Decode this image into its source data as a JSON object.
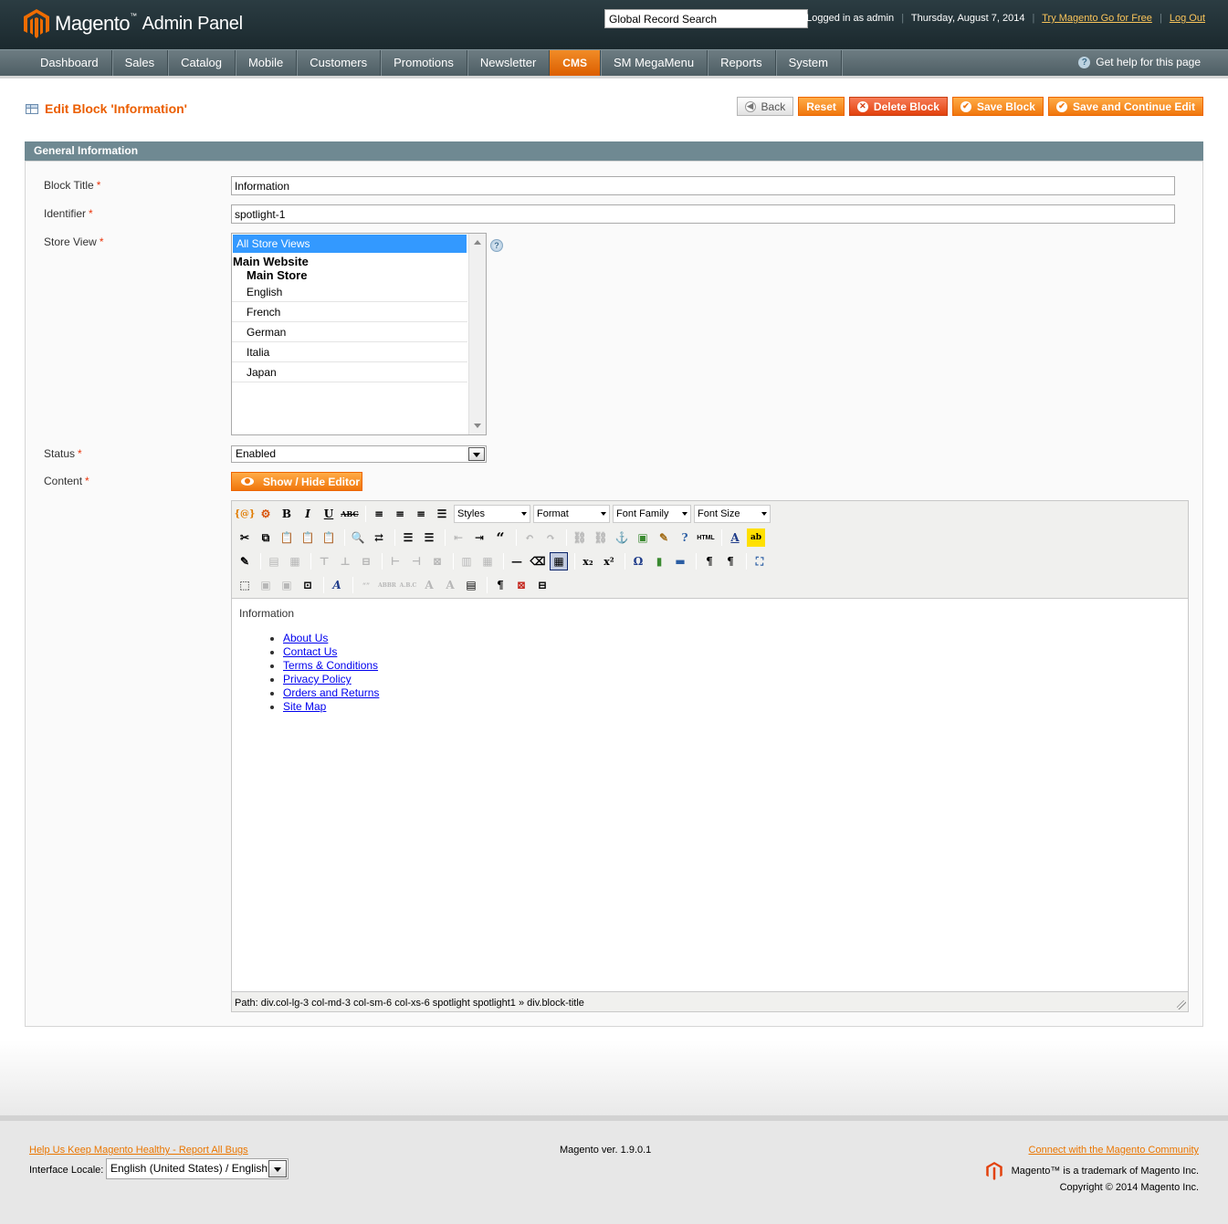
{
  "header": {
    "logo_text": "Magento",
    "logo_tm": "™",
    "logo_sub": "Admin Panel",
    "search_value": "Global Record Search",
    "logged_in": "Logged in as admin",
    "date": "Thursday, August 7, 2014",
    "try_link": "Try Magento Go for Free",
    "logout_link": "Log Out",
    "separator": "|"
  },
  "nav": {
    "items": [
      "Dashboard",
      "Sales",
      "Catalog",
      "Mobile",
      "Customers",
      "Promotions",
      "Newsletter",
      "CMS",
      "SM MegaMenu",
      "Reports",
      "System"
    ],
    "active": "CMS",
    "help": "Get help for this page"
  },
  "page": {
    "title": "Edit Block 'Information'",
    "buttons": {
      "back": "Back",
      "reset": "Reset",
      "delete": "Delete Block",
      "save": "Save Block",
      "save_continue": "Save and Continue Edit"
    }
  },
  "form": {
    "section_title": "General Information",
    "required_mark": "*",
    "block_title_label": "Block Title",
    "block_title_value": "Information",
    "identifier_label": "Identifier",
    "identifier_value": "spotlight-1",
    "store_view_label": "Store View",
    "store_views": {
      "all": "All Store Views",
      "website": "Main Website",
      "store": "Main Store",
      "views": [
        "English",
        "French",
        "German",
        "Italia",
        "Japan"
      ]
    },
    "status_label": "Status",
    "status_value": "Enabled",
    "content_label": "Content",
    "show_hide": "Show / Hide Editor"
  },
  "editor": {
    "selects": {
      "styles": "Styles",
      "format": "Format",
      "font_family": "Font Family",
      "font_size": "Font Size"
    },
    "content_heading": "Information",
    "links": [
      "About Us",
      "Contact Us",
      "Terms & Conditions",
      "Privacy Policy",
      "Orders and Returns",
      "Site Map"
    ],
    "path": "Path: div.col-lg-3 col-md-3 col-sm-6 col-xs-6 spotlight spotlight1 » div.block-title"
  },
  "footer": {
    "help_bugs": "Help Us Keep Magento Healthy - Report All Bugs",
    "locale_label": "Interface Locale:",
    "locale_value": "English (United States) / English",
    "version": "Magento ver. 1.9.0.1",
    "community": "Connect with the Magento Community",
    "trademark": "Magento™ is a trademark of Magento Inc.",
    "copyright": "Copyright © 2014 Magento Inc."
  },
  "colors": {
    "accent": "#eb5e00",
    "header_bg": "#1b292e",
    "nav_bg": "#5b6b71",
    "section_head": "#6f8992",
    "selected": "#3399ff"
  }
}
